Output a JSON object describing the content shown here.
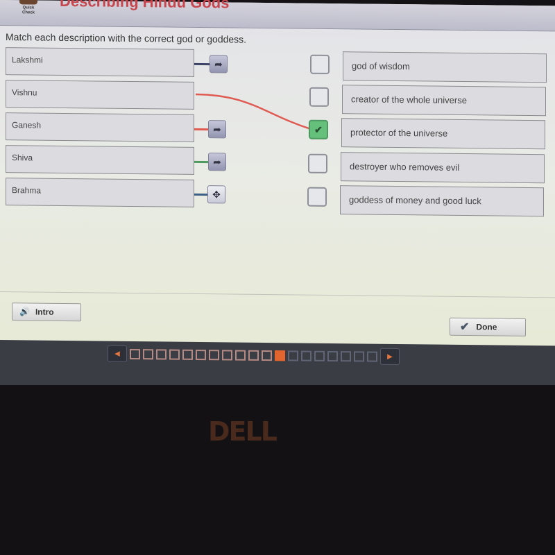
{
  "header": {
    "badge_label": "Quick Check",
    "title": "Describing Hindu Gods"
  },
  "instructions": "Match each description with the correct god or goddess.",
  "gods": [
    {
      "label": "Lakshmi",
      "connector_color": "#3d4466",
      "handle_icon": "arrow-icon",
      "connected": false
    },
    {
      "label": "Vishnu",
      "connector_color": "#e05a52",
      "handle_icon": "none",
      "connected": true,
      "connected_to": 2
    },
    {
      "label": "Ganesh",
      "connector_color": "#e05a52",
      "handle_icon": "arrow-icon",
      "connected": false
    },
    {
      "label": "Shiva",
      "connector_color": "#4f9a5e",
      "handle_icon": "arrow-icon",
      "connected": false
    },
    {
      "label": "Brahma",
      "connector_color": "#3c5f86",
      "handle_icon": "move-icon",
      "connected": false
    }
  ],
  "descriptions": [
    {
      "label": "god of wisdom",
      "checked": false
    },
    {
      "label": "creator of the whole universe",
      "checked": false
    },
    {
      "label": "protector of the universe",
      "checked": true
    },
    {
      "label": "destroyer who removes evil",
      "checked": false
    },
    {
      "label": "goddess of money and good luck",
      "checked": false
    }
  ],
  "footer": {
    "intro_label": "Intro",
    "done_label": "Done"
  },
  "pagination": {
    "total": 19,
    "current": 12,
    "visited_count": 11,
    "accent": "#e2652f"
  },
  "device": {
    "brand": "DELL"
  }
}
